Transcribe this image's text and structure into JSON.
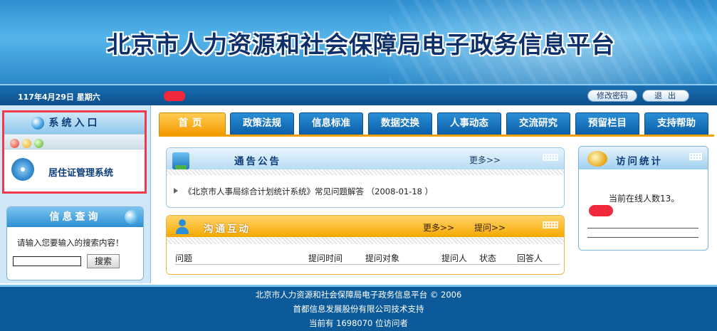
{
  "header": {
    "title": "北京市人力资源和社会保障局电子政务信息平台",
    "date": "117年4月29日 星期六",
    "change_password": "修改密码",
    "logout": "退出"
  },
  "system_entry": {
    "title": "系统入口",
    "link": "居住证管理系统"
  },
  "search": {
    "title": "信息查询",
    "prompt": "请输入您要输入的搜索内容！",
    "input_value": "",
    "button": "搜索"
  },
  "tabs": [
    {
      "label": "首页",
      "active": true
    },
    {
      "label": "政策法规",
      "active": false
    },
    {
      "label": "信息标准",
      "active": false
    },
    {
      "label": "数据交换",
      "active": false
    },
    {
      "label": "人事动态",
      "active": false
    },
    {
      "label": "交流研究",
      "active": false
    },
    {
      "label": "预留栏目",
      "active": false
    },
    {
      "label": "支持帮助",
      "active": false
    }
  ],
  "notice": {
    "title": "通告公告",
    "more": "更多>>",
    "items": [
      {
        "text": "《北京市人事局综合计划统计系统》常见问题解答 （2008-01-18 ）"
      }
    ]
  },
  "interaction": {
    "title": "沟通互动",
    "more": "更多>>",
    "ask": "提问>>",
    "columns": [
      "问题",
      "提问时间",
      "提问对象",
      "提问人",
      "状态",
      "回答人"
    ]
  },
  "stats": {
    "title": "访问统计",
    "online": "当前在线人数13。"
  },
  "footer": {
    "line1": "北京市人力资源和社会保障局电子政务信息平台 © 2006",
    "line2": "首都信息发展股份有限公司技术支持",
    "line3": "当前有  1698070  位访问者"
  },
  "colors": {
    "accent_blue": "#0c5a99",
    "tab_active": "#f39a00",
    "redaction": "#f0283c",
    "highlight_box": "#f03a4b"
  }
}
